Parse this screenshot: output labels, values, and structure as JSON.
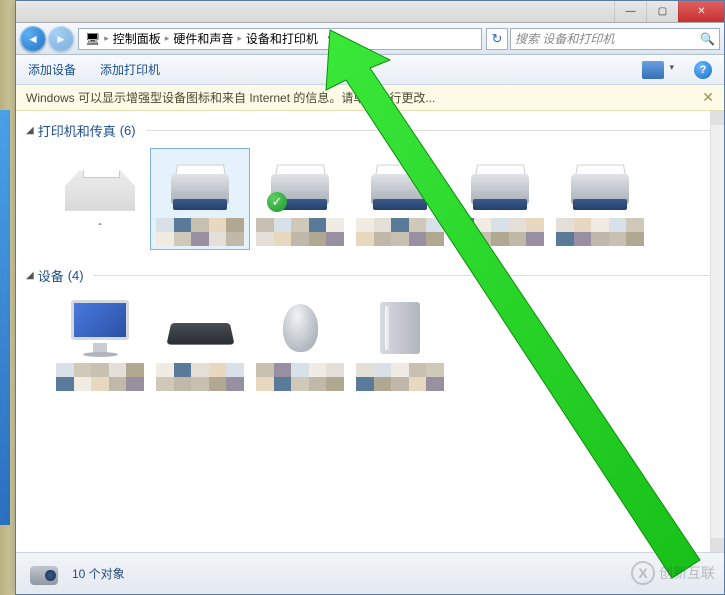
{
  "titlebar": {
    "min": "—",
    "max": "▢",
    "close": "✕"
  },
  "nav": {
    "back": "◄",
    "fwd": "►",
    "root_icon": "🖥",
    "crumb1": "控制面板",
    "crumb2": "硬件和声音",
    "crumb3": "设备和打印机",
    "dropdown": "▾",
    "refresh": "↻"
  },
  "search": {
    "placeholder": "搜索 设备和打印机",
    "icon": "🔍"
  },
  "toolbar": {
    "add_device": "添加设备",
    "add_printer": "添加打印机",
    "help": "?"
  },
  "infobar": {
    "text": "Windows 可以显示增强型设备图标和来自 Internet 的信息。请单击进行更改...",
    "close": "✕"
  },
  "groups": {
    "printers": {
      "label": "打印机和传真",
      "count": "(6)"
    },
    "devices": {
      "label": "设备",
      "count": "(4)"
    }
  },
  "status": {
    "text": "10 个对象"
  },
  "watermark": {
    "icon": "X",
    "text": "创新互联"
  }
}
